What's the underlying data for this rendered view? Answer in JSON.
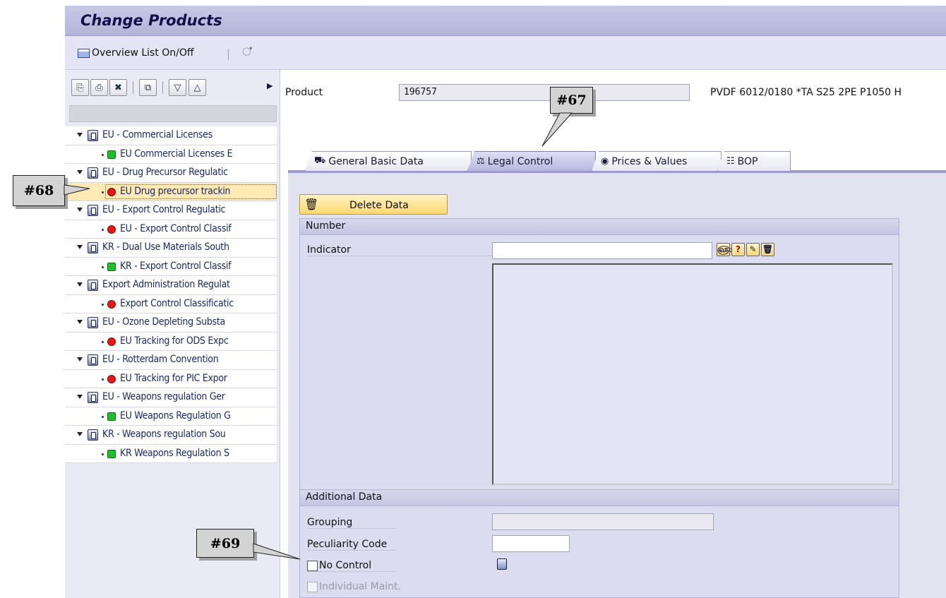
{
  "window": {
    "title": "Change Products"
  },
  "toolbar": {
    "overview_label": "Overview List On/Off",
    "other_icon": "glasses-icon"
  },
  "tree": {
    "items": [
      {
        "label": "EU - Commercial Licenses",
        "kind": "folder"
      },
      {
        "label": "EU Commercial Licenses E",
        "kind": "leaf",
        "status": "green"
      },
      {
        "label": "EU - Drug Precursor Regulatic",
        "kind": "folder"
      },
      {
        "label": "EU Drug precursor trackin",
        "kind": "leaf",
        "status": "red",
        "selected": true
      },
      {
        "label": "EU -  Export Control Regulatic",
        "kind": "folder"
      },
      {
        "label": "EU - Export Control Classif",
        "kind": "leaf",
        "status": "red"
      },
      {
        "label": "KR - Dual Use Materials South",
        "kind": "folder"
      },
      {
        "label": "KR - Export Control Classif",
        "kind": "leaf",
        "status": "green"
      },
      {
        "label": "Export Administration Regulat",
        "kind": "folder"
      },
      {
        "label": "Export Control Classificatic",
        "kind": "leaf",
        "status": "red"
      },
      {
        "label": "EU -  Ozone Depleting Substa",
        "kind": "folder"
      },
      {
        "label": "EU Tracking for ODS Expc",
        "kind": "leaf",
        "status": "red"
      },
      {
        "label": "EU -  Rotterdam Convention",
        "kind": "folder"
      },
      {
        "label": "EU Tracking for PIC Expor",
        "kind": "leaf",
        "status": "red"
      },
      {
        "label": "EU - Weapons regulation Ger",
        "kind": "folder"
      },
      {
        "label": "EU Weapons Regulation G",
        "kind": "leaf",
        "status": "green"
      },
      {
        "label": "KR - Weapons regulation Sou",
        "kind": "folder"
      },
      {
        "label": "KR Weapons Regulation S",
        "kind": "leaf",
        "status": "green"
      }
    ]
  },
  "product": {
    "label": "Product",
    "value": "196757",
    "description": "PVDF 6012/0180 *TA S25 2PE P1050 H"
  },
  "tabs": [
    {
      "label": "General Basic Data",
      "icon": "truck-icon"
    },
    {
      "label": "Legal Control",
      "icon": "scales-icon",
      "active": true
    },
    {
      "label": "Prices & Values",
      "icon": "coin-icon"
    },
    {
      "label": "BOP",
      "icon": "hierarchy-icon"
    }
  ],
  "actions": {
    "delete_label": "Delete Data"
  },
  "number_group": {
    "title": "Number",
    "indicator_label": "Indicator",
    "indicator_value": ""
  },
  "additional_group": {
    "title": "Additional Data",
    "grouping_label": "Grouping",
    "grouping_value": "",
    "peculiarity_label": "Peculiarity Code",
    "peculiarity_value": "",
    "no_control_label": "No Control",
    "no_control_checked": false,
    "individual_label": "Individual Maint.",
    "individual_checked": false
  },
  "callouts": {
    "c67": "#67",
    "c68": "#68",
    "c69": "#69"
  }
}
